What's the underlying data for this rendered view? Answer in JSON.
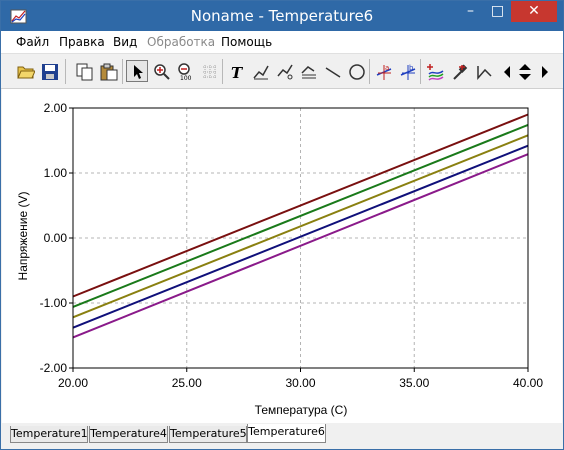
{
  "window": {
    "title": "Noname - Temperature6",
    "minimize": "–",
    "maximize": "□",
    "close": "✕"
  },
  "menu": {
    "items": [
      {
        "label": "Файл",
        "enabled": true
      },
      {
        "label": "Правка",
        "enabled": true
      },
      {
        "label": "Вид",
        "enabled": true
      },
      {
        "label": "Обработка",
        "enabled": false
      },
      {
        "label": "Помощь",
        "enabled": true
      }
    ]
  },
  "toolbar": {
    "icons": [
      "open-icon",
      "save-icon",
      "copy-icon",
      "paste-icon",
      "pointer-icon",
      "zoom-in-icon",
      "zoom-100-icon",
      "grid-icon",
      "text-icon",
      "annotate-1-icon",
      "annotate-2-icon",
      "annotate-3-icon",
      "line-icon",
      "ellipse-icon",
      "cursor-a-icon",
      "cursor-b-icon",
      "add-trace-icon",
      "probe-icon",
      "marker-icon",
      "scroll-left-icon",
      "scroll-updown-icon",
      "scroll-right-icon"
    ],
    "labels": {
      "text_tool": "T",
      "zoom_100": "100",
      "cursor_a": "a",
      "cursor_b": "b"
    }
  },
  "tabs": [
    {
      "label": "Temperature1",
      "active": false
    },
    {
      "label": "Temperature4",
      "active": false
    },
    {
      "label": "Temperature5",
      "active": false
    },
    {
      "label": "Temperature6",
      "active": true
    }
  ],
  "chart_data": {
    "type": "line",
    "title": "",
    "xlabel": "Температура (C)",
    "ylabel": "Напряжение (V)",
    "xlim": [
      20,
      40
    ],
    "ylim": [
      -2,
      2
    ],
    "x_ticks": [
      "20.00",
      "25.00",
      "30.00",
      "35.00",
      "40.00"
    ],
    "y_ticks": [
      "2.00",
      "1.00",
      "0.00",
      "-1.00",
      "-2.00"
    ],
    "grid": true,
    "legend": "none",
    "x": [
      20,
      40
    ],
    "series": [
      {
        "color": "#7a1010",
        "values": [
          -0.9,
          1.9
        ]
      },
      {
        "color": "#1a7a1a",
        "values": [
          -1.06,
          1.74
        ]
      },
      {
        "color": "#8a8010",
        "values": [
          -1.22,
          1.58
        ]
      },
      {
        "color": "#10107a",
        "values": [
          -1.38,
          1.42
        ]
      },
      {
        "color": "#8a1a8a",
        "values": [
          -1.53,
          1.29
        ]
      }
    ]
  }
}
